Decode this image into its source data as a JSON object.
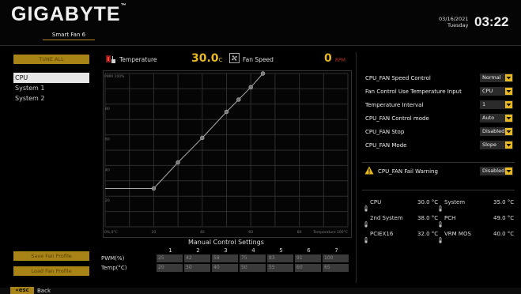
{
  "header": {
    "brand": "GIGABYTE",
    "trademark": "™",
    "subtitle": "Smart Fan 6",
    "date": "03/16/2021",
    "weekday": "Tuesday",
    "time": "03:22"
  },
  "sidebar": {
    "tune_all": "TUNE ALL",
    "fans": [
      "CPU",
      "System 1",
      "System 2"
    ],
    "selected": "CPU",
    "save_label": "Save Fan Profile",
    "load_label": "Load Fan Profile"
  },
  "readout": {
    "temp_label": "Temperature",
    "temp_value": "30.0",
    "temp_unit": "°C",
    "fan_label": "Fan Speed",
    "rpm_value": "0",
    "rpm_unit": "RPM"
  },
  "chart_data": {
    "type": "line",
    "y_axis_title": "PWM 100%",
    "x_axis_title": "Temperature 100°C",
    "y_ticks": [
      "80",
      "60",
      "40",
      "20"
    ],
    "x_ticks": [
      "20",
      "40",
      "60",
      "80"
    ],
    "origin_label": "0%,0°C",
    "xlim": [
      0,
      100
    ],
    "ylim": [
      0,
      100
    ],
    "grid": true,
    "points": [
      {
        "temp": 20,
        "pwm": 25
      },
      {
        "temp": 30,
        "pwm": 42
      },
      {
        "temp": 40,
        "pwm": 58
      },
      {
        "temp": 50,
        "pwm": 75
      },
      {
        "temp": 55,
        "pwm": 83
      },
      {
        "temp": 60,
        "pwm": 91
      },
      {
        "temp": 65,
        "pwm": 100
      }
    ]
  },
  "manual": {
    "title": "Manual Control Settings",
    "columns": [
      "1",
      "2",
      "3",
      "4",
      "5",
      "6",
      "7"
    ],
    "pwm_label": "PWM(%)",
    "temp_label": "Temp(°C)",
    "pwm": [
      "25",
      "42",
      "58",
      "75",
      "83",
      "91",
      "100"
    ],
    "temp": [
      "20",
      "30",
      "40",
      "50",
      "55",
      "60",
      "65"
    ]
  },
  "settings": [
    {
      "label": "CPU_FAN Speed Control",
      "value": "Normal"
    },
    {
      "label": "Fan Control Use Temperature Input",
      "value": "CPU"
    },
    {
      "label": "Temperature Interval",
      "value": "1"
    },
    {
      "label": "CPU_FAN Control mode",
      "value": "Auto"
    },
    {
      "label": "CPU_FAN Stop",
      "value": "Disabled"
    },
    {
      "label": "CPU_FAN Mode",
      "value": "Slope"
    }
  ],
  "warning": {
    "label": "CPU_FAN Fail Warning",
    "value": "Disabled"
  },
  "temps": [
    {
      "name": "CPU",
      "value": "30.0 °C"
    },
    {
      "name": "System",
      "value": "35.0 °C"
    },
    {
      "name": "2nd System",
      "value": "38.0 °C"
    },
    {
      "name": "PCH",
      "value": "49.0 °C"
    },
    {
      "name": "PCIEX16",
      "value": "32.0 °C"
    },
    {
      "name": "VRM MOS",
      "value": "40.0 °C"
    }
  ],
  "footer": {
    "esc": "esc",
    "back": "Back"
  },
  "colors": {
    "accent": "#e8b922",
    "button": "#a88316",
    "rpm_unit": "#c0392b"
  }
}
